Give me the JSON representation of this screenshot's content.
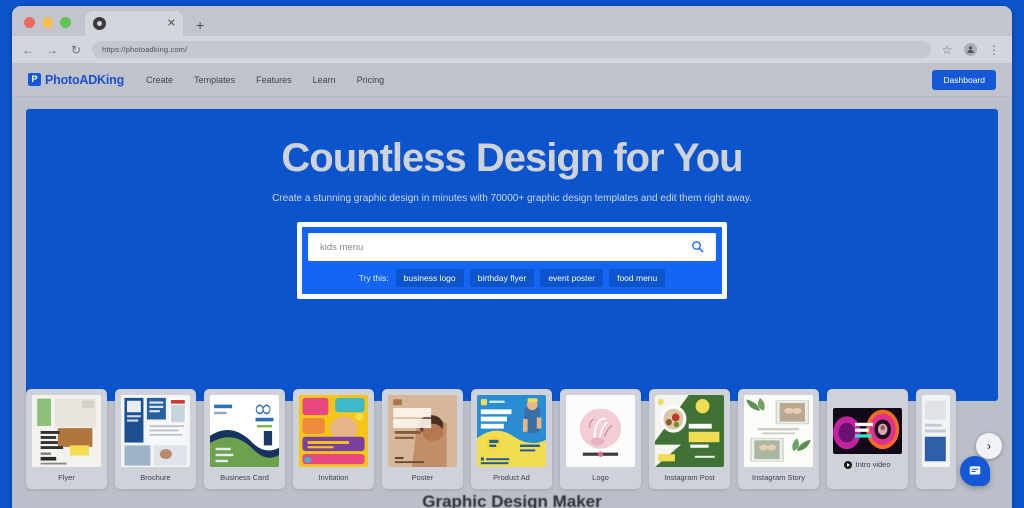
{
  "browser": {
    "tab": {
      "title": "",
      "favicon": "chrome-favicon",
      "close_label": "✕"
    },
    "new_tab_label": "+",
    "back_icon": "←",
    "forward_icon": "→",
    "reload_icon": "↻",
    "url": "https://photoadking.com/",
    "bookmark_icon": "☆",
    "profile_icon": "●",
    "menu_icon": "⋮"
  },
  "site": {
    "logo": {
      "mark": "P",
      "text": "PhotoADKing"
    },
    "nav": [
      {
        "label": "Create"
      },
      {
        "label": "Templates"
      },
      {
        "label": "Features"
      },
      {
        "label": "Learn"
      },
      {
        "label": "Pricing"
      }
    ],
    "dashboard_button": "Dashboard"
  },
  "hero": {
    "title": "Countless Design for You",
    "subtitle": "Create a stunning graphic design in minutes with 70000+ graphic design templates and edit them right away.",
    "search": {
      "value": "kids menu",
      "placeholder": "kids menu",
      "search_icon": "search-icon",
      "try_label": "Try this:",
      "chips": [
        {
          "label": "business logo"
        },
        {
          "label": "birthday flyer"
        },
        {
          "label": "event poster"
        },
        {
          "label": "food menu"
        }
      ]
    },
    "accent_color": "#0B54CC",
    "search_band_color": "#1565F5"
  },
  "carousel": {
    "next_icon": "›",
    "cards": [
      {
        "label": "Flyer",
        "thumb": "flyer"
      },
      {
        "label": "Brochure",
        "thumb": "brochure"
      },
      {
        "label": "Business Card",
        "thumb": "business-card"
      },
      {
        "label": "Invitation",
        "thumb": "invitation"
      },
      {
        "label": "Poster",
        "thumb": "poster"
      },
      {
        "label": "Product Ad",
        "thumb": "product-ad"
      },
      {
        "label": "Logo",
        "thumb": "logo"
      },
      {
        "label": "Instagram Post",
        "thumb": "instagram-post"
      },
      {
        "label": "Instagram Story",
        "thumb": "instagram-story"
      },
      {
        "label": "Intro video",
        "thumb": "intro-video",
        "has_play_icon": true
      },
      {
        "label": "",
        "thumb": "partial"
      }
    ]
  },
  "lower_section": {
    "heading": "Graphic Design Maker"
  },
  "chat": {
    "icon": "chat-bubble-icon"
  }
}
